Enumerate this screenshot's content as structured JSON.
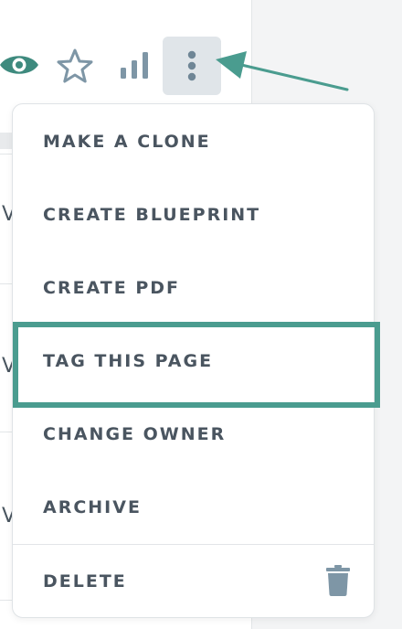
{
  "toolbar": {
    "buttons": [
      {
        "icon": "eye-icon",
        "color": "#3e8a7e"
      },
      {
        "icon": "star-icon",
        "color": "#7e96a6"
      },
      {
        "icon": "bar-chart-icon",
        "color": "#7e96a6"
      },
      {
        "icon": "more-vertical-icon",
        "color": "#6f8696"
      }
    ]
  },
  "menu": {
    "items": [
      {
        "label": "MAKE A CLONE"
      },
      {
        "label": "CREATE BLUEPRINT"
      },
      {
        "label": "CREATE PDF"
      },
      {
        "label": "TAG THIS PAGE",
        "highlighted": true
      },
      {
        "label": "CHANGE OWNER"
      },
      {
        "label": "ARCHIVE"
      }
    ],
    "delete": {
      "label": "DELETE",
      "icon": "trash-icon"
    }
  },
  "annotation": {
    "arrow_color": "#4a9c8f",
    "highlight_color": "#4a9c8f"
  },
  "background": {
    "glyph": "V"
  }
}
